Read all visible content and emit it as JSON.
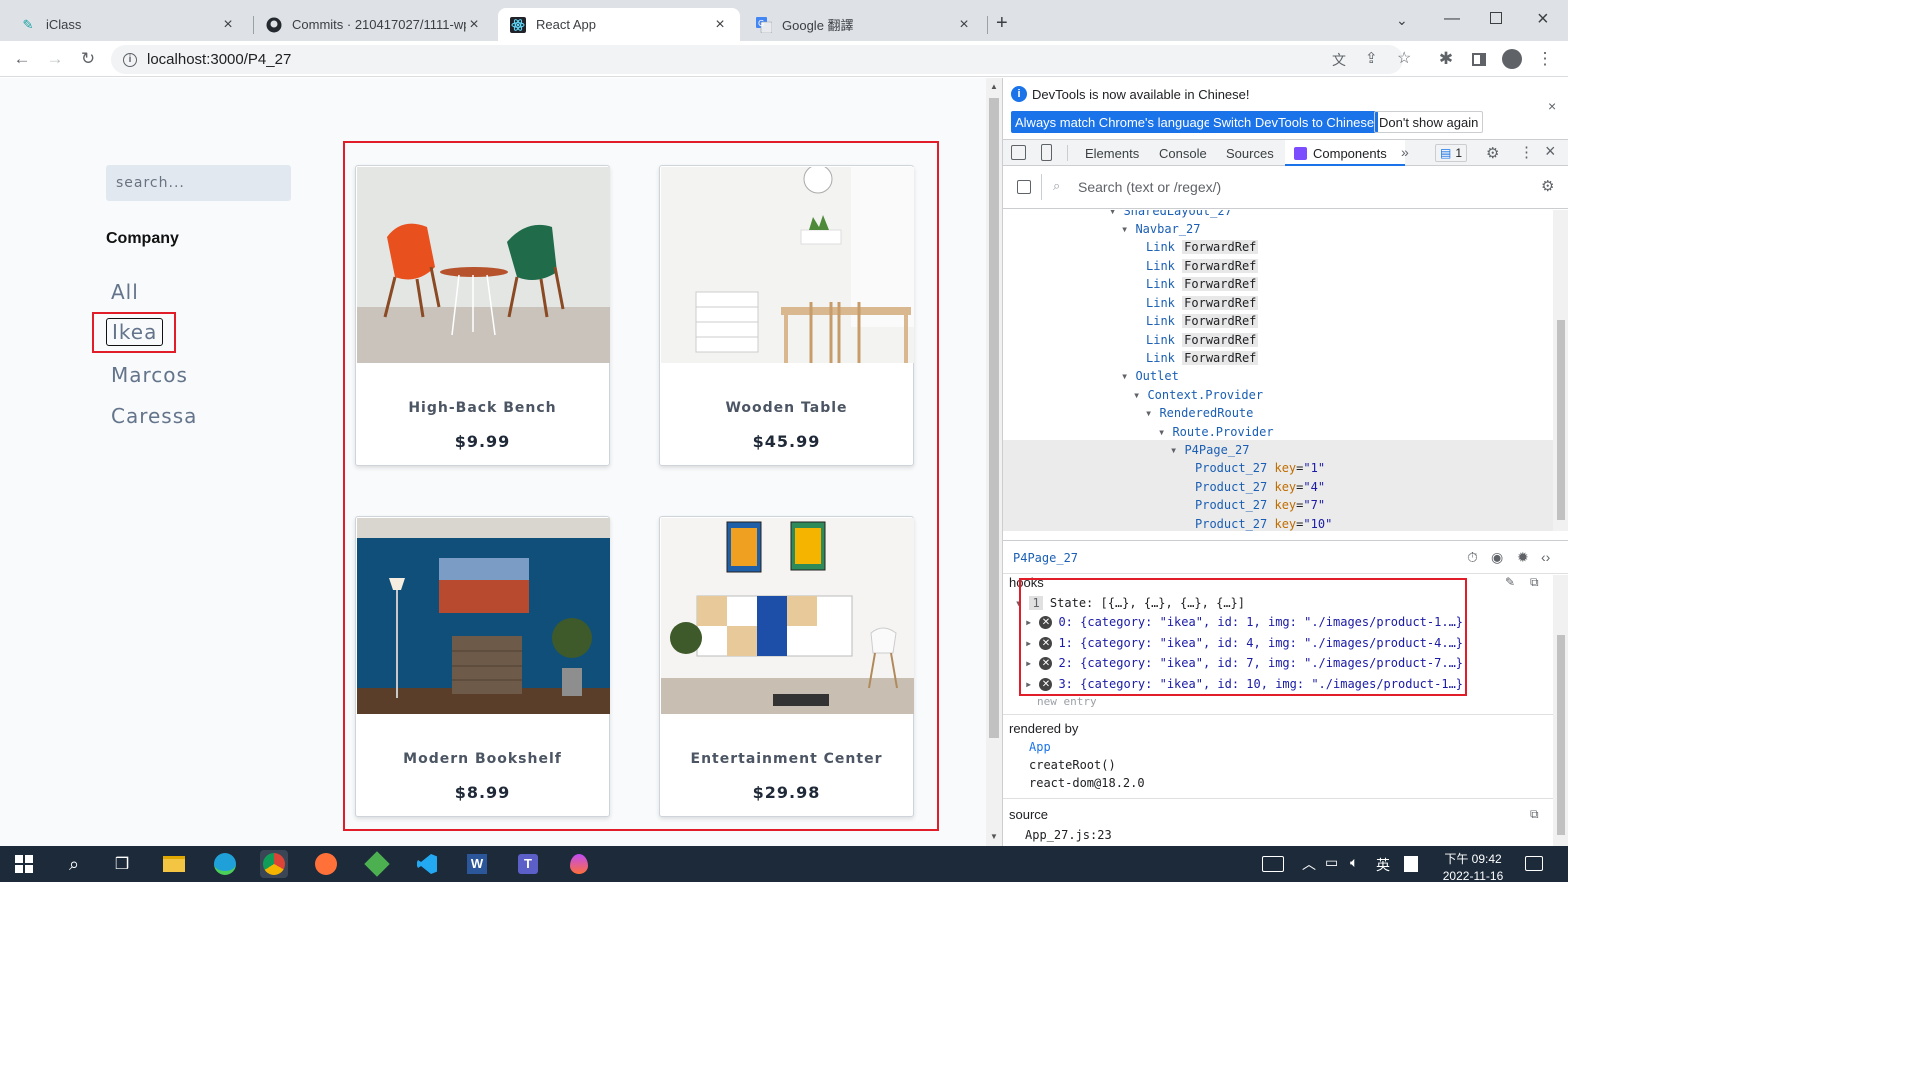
{
  "browser": {
    "tabs": [
      {
        "title": "iClass",
        "icon": "iclass-icon"
      },
      {
        "title": "Commits · 210417027/1111-wp",
        "icon": "github-icon"
      },
      {
        "title": "React App",
        "icon": "react-icon"
      },
      {
        "title": "Google 翻譯",
        "icon": "google-translate-icon"
      }
    ],
    "url": "localhost:3000/P4_27"
  },
  "page": {
    "search_placeholder": "search...",
    "company_heading": "Company",
    "categories": [
      "All",
      "Ikea",
      "Marcos",
      "Caressa"
    ],
    "selected_category": "Ikea",
    "products": [
      {
        "name": "High-Back Bench",
        "price": "$9.99"
      },
      {
        "name": "Wooden Table",
        "price": "$45.99"
      },
      {
        "name": "Modern Bookshelf",
        "price": "$8.99"
      },
      {
        "name": "Entertainment Center",
        "price": "$29.98"
      }
    ]
  },
  "devtools": {
    "banner_text": "DevTools is now available in Chinese!",
    "btn_match": "Always match Chrome's language",
    "btn_switch": "Switch DevTools to Chinese",
    "btn_dont": "Don't show again",
    "tabs": [
      "Elements",
      "Console",
      "Sources",
      "Components"
    ],
    "issues_count": "1",
    "search_placeholder": "Search (text or /regex/)",
    "tree": {
      "shared": "SharedLayout_27",
      "navbar": "Navbar_27",
      "link": "Link",
      "forwardref": "ForwardRef",
      "outlet": "Outlet",
      "context": "Context.Provider",
      "rendered": "RenderedRoute",
      "route": "Route.Provider",
      "p4page": "P4Page_27",
      "product": "Product_27",
      "key_label": "key",
      "keys": [
        "\"1\"",
        "\"4\"",
        "\"7\"",
        "\"10\""
      ]
    },
    "selected_component": "P4Page_27",
    "hooks_label": "hooks",
    "hook_index": "1",
    "state_line": "State: [{…}, {…}, {…}, {…}]",
    "state_items": [
      "0: {category: \"ikea\", id: 1, img: \"./images/product-1.…}",
      "1: {category: \"ikea\", id: 4, img: \"./images/product-4.…}",
      "2: {category: \"ikea\", id: 7, img: \"./images/product-7.…}",
      "3: {category: \"ikea\", id: 10, img: \"./images/product-1…}"
    ],
    "new_entry": "new entry",
    "rendered_by_label": "rendered by",
    "rendered_by": [
      "App",
      "createRoot()",
      "react-dom@18.2.0"
    ],
    "source_label": "source",
    "source_value": "App_27.js:23"
  },
  "taskbar": {
    "time": "下午 09:42",
    "date": "2022-11-16",
    "ime": "英"
  },
  "colors": {
    "highlight_red": "#e11d2a",
    "devtools_blue": "#1a73e8",
    "taskbar": "#1c2a3a"
  }
}
